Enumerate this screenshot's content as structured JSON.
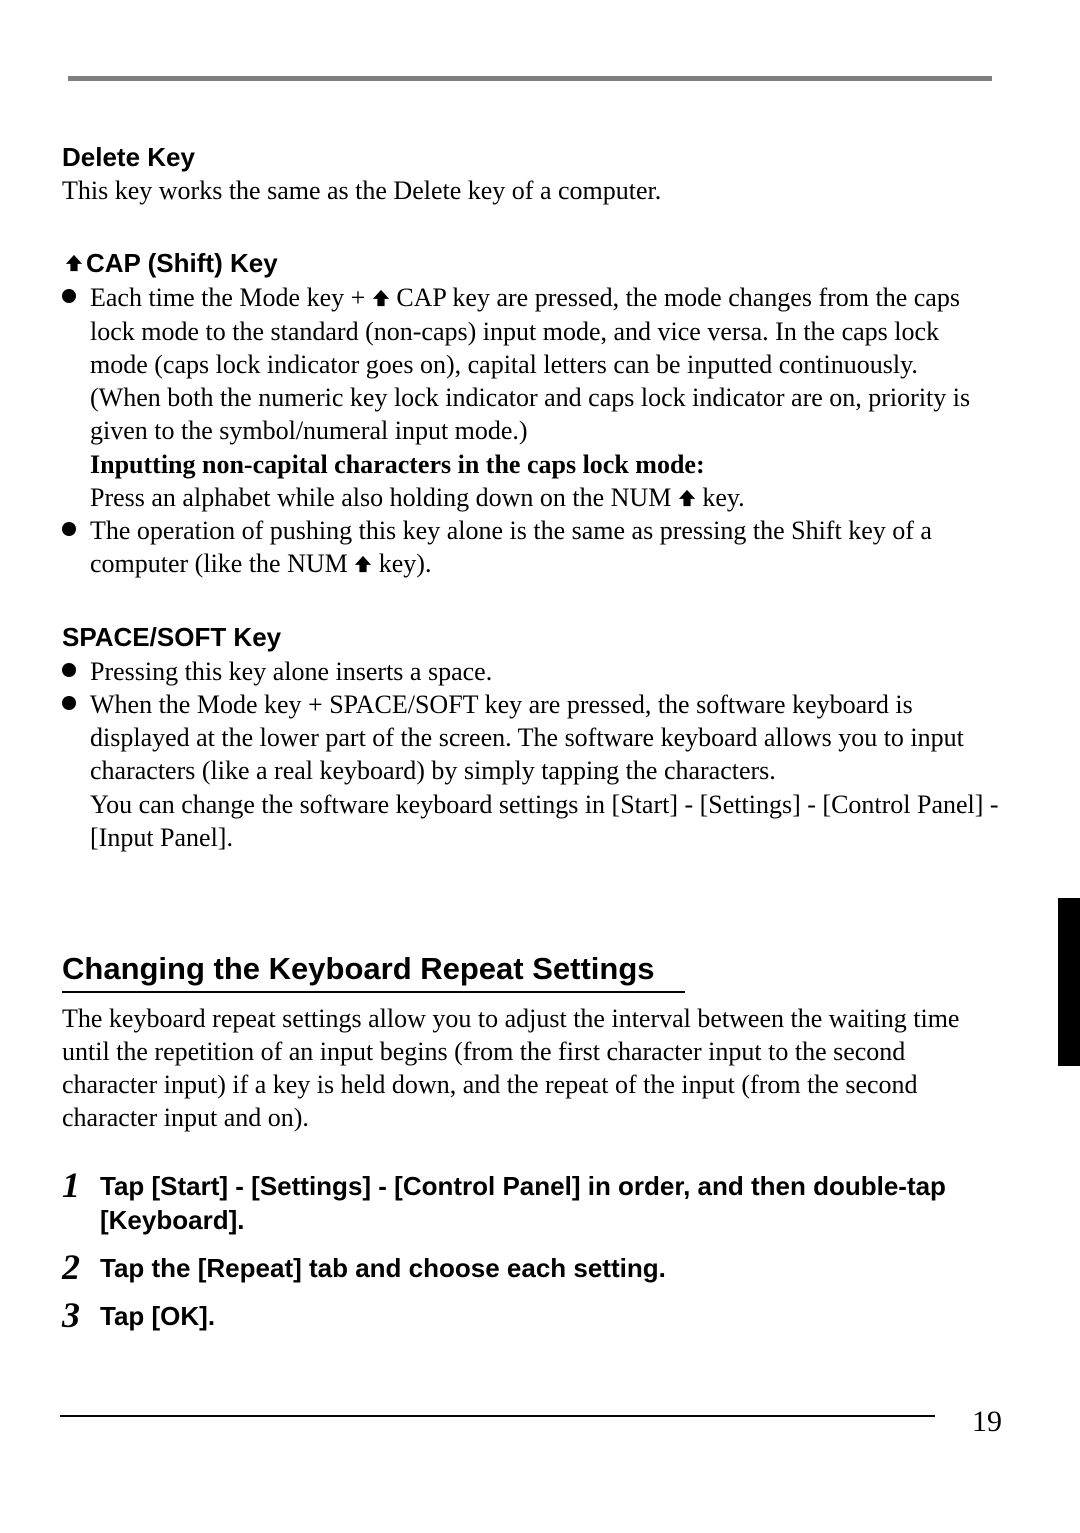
{
  "pageNumber": "19",
  "sections": {
    "deleteKey": {
      "heading": "Delete Key",
      "body": "This key works the same as the Delete key of a computer."
    },
    "capKey": {
      "heading": " CAP (Shift) Key",
      "bullets": [
        {
          "para1a": "Each time the Mode key + ",
          "para1b": " CAP key are pressed, the mode changes from the caps lock mode to the standard (non-caps) input mode, and vice versa. In the caps lock mode (caps lock indicator goes on), capital letters can be inputted continuously.",
          "para2": "(When both the numeric key lock indicator and caps lock indicator are on, priority is given to the symbol/numeral input mode.)",
          "subheading": "Inputting non-capital characters in the caps lock mode:",
          "para3a": "Press an alphabet while also holding down on the NUM ",
          "para3b": " key."
        },
        {
          "para1a": "The operation of pushing this key alone is the same as pressing the Shift key of a computer (like the NUM ",
          "para1b": " key)."
        }
      ]
    },
    "spaceSoft": {
      "heading": "SPACE/SOFT Key",
      "bullets": [
        "Pressing this key alone inserts a space.",
        "When the Mode key + SPACE/SOFT key are pressed, the software keyboard is displayed at the lower part of the screen. The software keyboard allows you to input characters (like a real keyboard) by simply tapping the characters."
      ],
      "extra": "You can change the software keyboard  settings in [Start] - [Settings] - [Control Panel] - [Input Panel]."
    },
    "changing": {
      "title": "Changing the Keyboard Repeat Settings",
      "body": "The keyboard repeat settings allow you to adjust the interval between the waiting time until the repetition of an input begins (from the first character input to the second character input) if a key is held down, and the repeat of the input (from the second character input and on).",
      "steps": [
        "Tap [Start] - [Settings] - [Control Panel] in order, and then double-tap [Keyboard].",
        "Tap the [Repeat] tab and choose each setting.",
        "Tap [OK]."
      ]
    }
  }
}
